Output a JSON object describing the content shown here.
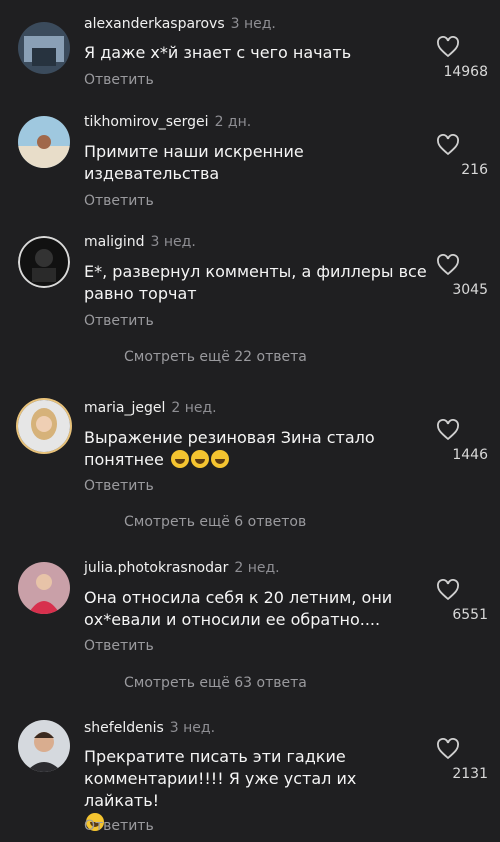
{
  "comments": [
    {
      "user": "alexanderkasparovs",
      "time": "3 нед.",
      "text": "Я даже х*й знает с чего начать",
      "reply": "Ответить",
      "likes": "14968"
    },
    {
      "user": "tikhomirov_sergei",
      "time": "2 дн.",
      "text": "Примите наши искренние издевательства",
      "reply": "Ответить",
      "likes": "216"
    },
    {
      "user": "maligind",
      "time": "3 нед.",
      "text": "Е*, развернул комменты, а филлеры все равно торчат",
      "reply": "Ответить",
      "likes": "3045",
      "more": "Смотреть ещё 22 ответа"
    },
    {
      "user": "maria_jegel",
      "time": "2 нед.",
      "text": "Выражение резиновая Зина стало понятнее",
      "reply": "Ответить",
      "likes": "1446",
      "more": "Смотреть ещё 6 ответов"
    },
    {
      "user": "julia.photokrasnodar",
      "time": "2 нед.",
      "text": "Она относила себя к 20 летним, они ох*евали и относили ее обратно....",
      "reply": "Ответить",
      "likes": "6551",
      "more": "Смотреть ещё 63 ответа"
    },
    {
      "user": "shefeldenis",
      "time": "3 нед.",
      "text": "Прекратите писать эти гадкие комментарии!!!! Я уже устал их лайкать!",
      "reply": "Ответить",
      "likes": "2131"
    }
  ],
  "icons": {
    "like": "heart-outline-icon",
    "avatar": "avatar-photo"
  }
}
